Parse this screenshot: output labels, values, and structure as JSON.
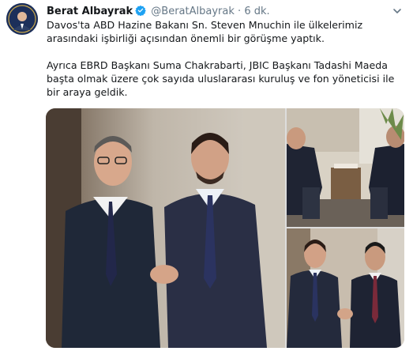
{
  "tweet": {
    "author_name": "Berat Albayrak",
    "author_handle": "@BeratAlbayrak",
    "separator": "·",
    "timestamp": "6 dk.",
    "paragraph_1": "Davos'ta ABD Hazine Bakanı Sn. Steven Mnuchin ile ülkelerimiz arasındaki işbirliği açısından önemli bir görüşme yaptık.",
    "paragraph_2": "Ayrıca EBRD Başkanı Suma Chakrabarti, JBIC Başkanı Tadashi Maeda başta olmak üzere çok sayıda uluslararası kuruluş ve fon yöneticisi ile bir araya geldik."
  },
  "media": {
    "photos": [
      "photo-handshake-main",
      "photo-seated-meeting",
      "photo-handshake-second"
    ]
  },
  "icons": {
    "verified": "verified-badge-icon",
    "menu": "chevron-down-icon"
  },
  "colors": {
    "accent": "#1da1f2",
    "text": "#14171a",
    "muted": "#657786"
  }
}
